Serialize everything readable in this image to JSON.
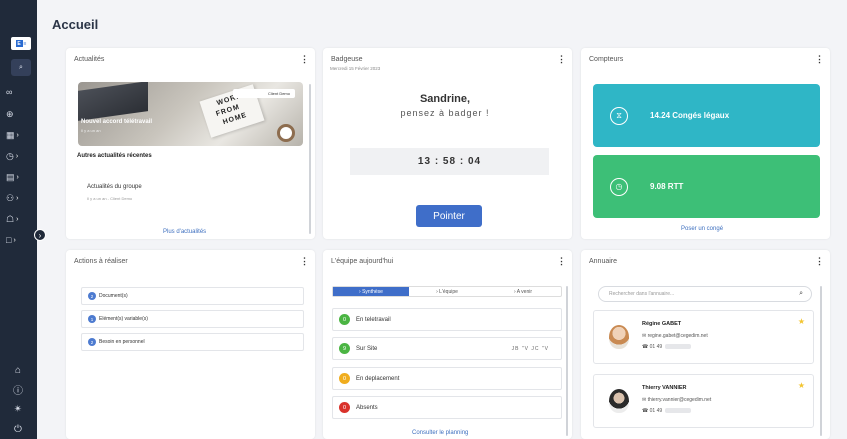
{
  "page": {
    "title": "Accueil"
  },
  "sidebar": {
    "logo_text": "■ ≡",
    "search_icon": "⌕",
    "items": [
      {
        "icon": "glasses-icon",
        "glyph": "∞",
        "chev": ""
      },
      {
        "icon": "search-person-icon",
        "glyph": "⊕",
        "chev": ""
      },
      {
        "icon": "calendar-icon",
        "glyph": "▦",
        "chev": "›"
      },
      {
        "icon": "clock-icon",
        "glyph": "◷",
        "chev": "›"
      },
      {
        "icon": "card-icon",
        "glyph": "▤",
        "chev": "›"
      },
      {
        "icon": "people-icon",
        "glyph": "⚇",
        "chev": "›"
      },
      {
        "icon": "org-icon",
        "glyph": "☖",
        "chev": "›"
      },
      {
        "icon": "document-icon",
        "glyph": "□",
        "chev": "›"
      }
    ],
    "toggle": "›",
    "bottom": [
      {
        "icon": "home-icon",
        "glyph": "⌂"
      },
      {
        "icon": "help-icon",
        "glyph": "ⓘ"
      },
      {
        "icon": "rocket-icon",
        "glyph": "✴"
      },
      {
        "icon": "power-icon",
        "glyph": "⏻"
      }
    ]
  },
  "actualites": {
    "title": "Actualités",
    "menu": "⋮",
    "client_tag": "Client Demo",
    "image_text_1": "WORK",
    "image_text_2": "FROM",
    "image_text_3": "HOME",
    "news_caption": "Nouvel accord télétravail",
    "news_sub": "Il y a un an",
    "recent_title": "Autres actualités récentes",
    "group_title": "Actualités du groupe",
    "group_sub": "Il y a un an - Client Demo",
    "more_link": "Plus d'actualités"
  },
  "badgeuse": {
    "title": "Badgeuse",
    "menu": "⋮",
    "date": "Mercredi 15 Février 2023",
    "name": "Sandrine,",
    "message": "pensez à badger !",
    "clock": "13 : 58 : 04",
    "button": "Pointer"
  },
  "compteurs": {
    "title": "Compteurs",
    "menu": "⋮",
    "items": [
      {
        "icon": "clock-search-icon",
        "glyph": "⧖",
        "value": "14.24 Congés légaux",
        "color": "#2fb6c6"
      },
      {
        "icon": "clock-icon",
        "glyph": "◷",
        "value": "9.08 RTT",
        "color": "#3dbf77"
      }
    ],
    "link": "Poser un congé"
  },
  "actions": {
    "title": "Actions à réaliser",
    "menu": "⋮",
    "items": [
      {
        "num": "2",
        "label": "Document(s)"
      },
      {
        "num": "1",
        "label": "Elément(s) variable(s)"
      },
      {
        "num": "2",
        "label": "Besoin en personnel"
      }
    ]
  },
  "equipe": {
    "title": "L'équipe aujourd'hui",
    "menu": "⋮",
    "tabs": [
      "›  Synthèse",
      "›  L'équipe",
      "›  A venir"
    ],
    "rows": [
      {
        "count": "0",
        "label": "En teletravail",
        "color": "#4bb543",
        "initials": ""
      },
      {
        "count": "9",
        "label": "Sur Site",
        "color": "#4bb543",
        "initials": "JB \"V JC \"V"
      },
      {
        "count": "0",
        "label": "En deplacement",
        "color": "#f0ad1e",
        "initials": ""
      },
      {
        "count": "0",
        "label": "Absents",
        "color": "#d9322b",
        "initials": ""
      }
    ],
    "link": "Consulter le planning"
  },
  "annuaire": {
    "title": "Annuaire",
    "menu": "⋮",
    "search_placeholder": "Rechercher dans l'annuaire...",
    "search_icon": "⌕",
    "people": [
      {
        "name": "Régine GABET",
        "email": "regine.gabet@cegedim.net",
        "phone": "01 49",
        "mail_icon": "✉",
        "phone_icon": "☎",
        "star": "★"
      },
      {
        "name": "Thierry VANNIER",
        "email": "thierry.vannier@cegedim.net",
        "phone": "01 49",
        "mail_icon": "✉",
        "phone_icon": "☎",
        "star": "★"
      }
    ]
  }
}
